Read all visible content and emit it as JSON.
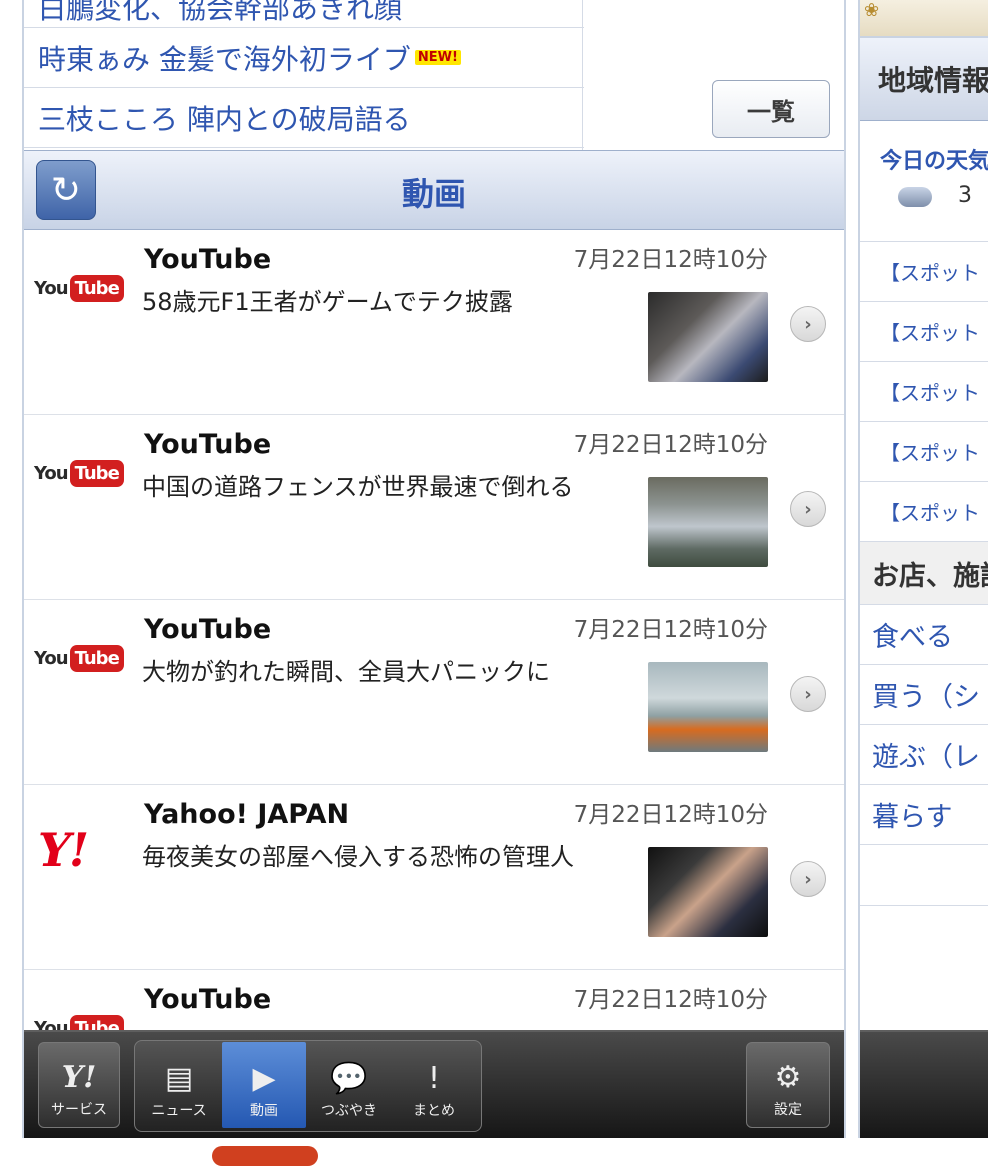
{
  "news": {
    "items": [
      {
        "text": "白鵬変化、協会幹部あきれ顔"
      },
      {
        "text": "時東ぁみ 金髪で海外初ライブ",
        "badge": "NEW!"
      },
      {
        "text": "三枝こころ 陣内との破局語る"
      }
    ],
    "all_button": "一覧"
  },
  "section": {
    "title": "動画",
    "refresh_icon": "refresh-icon"
  },
  "videos": [
    {
      "source": "YouTube",
      "time": "7月22日12時10分",
      "title": "58歳元F1王者がゲームでテク披露",
      "logo": "You Tube"
    },
    {
      "source": "YouTube",
      "time": "7月22日12時10分",
      "title": "中国の道路フェンスが世界最速で倒れる",
      "logo": "You Tube"
    },
    {
      "source": "YouTube",
      "time": "7月22日12時10分",
      "title": "大物が釣れた瞬間、全員大パニックに",
      "logo": "You Tube"
    },
    {
      "source": "Yahoo! JAPAN",
      "time": "7月22日12時10分",
      "title": "毎夜美女の部屋へ侵入する恐怖の管理人",
      "logo": "Y!"
    },
    {
      "source": "YouTube",
      "time": "7月22日12時10分",
      "title": "",
      "logo": "You Tube"
    }
  ],
  "tabbar": {
    "service": "サービス",
    "news": "ニュース",
    "video": "動画",
    "tweet": "つぶやき",
    "summary": "まとめ",
    "settings": "設定",
    "active": "video",
    "active_color": "#2e66c0"
  },
  "right_panel": {
    "header": "地域情報",
    "weather_title": "今日の天気",
    "weather_temp": "3",
    "links": [
      "【スポット",
      "【スポット",
      "【スポット",
      "【スポット",
      "【スポット"
    ],
    "category_header": "お店、施設",
    "category_links": [
      "食べる",
      "買う（シ",
      "遊ぶ（レ",
      "暮らす"
    ]
  },
  "colors": {
    "link": "#2f56b0",
    "youtube_red": "#d21f1f",
    "yahoo_red": "#e2001a",
    "indicator": "#d0401f"
  }
}
